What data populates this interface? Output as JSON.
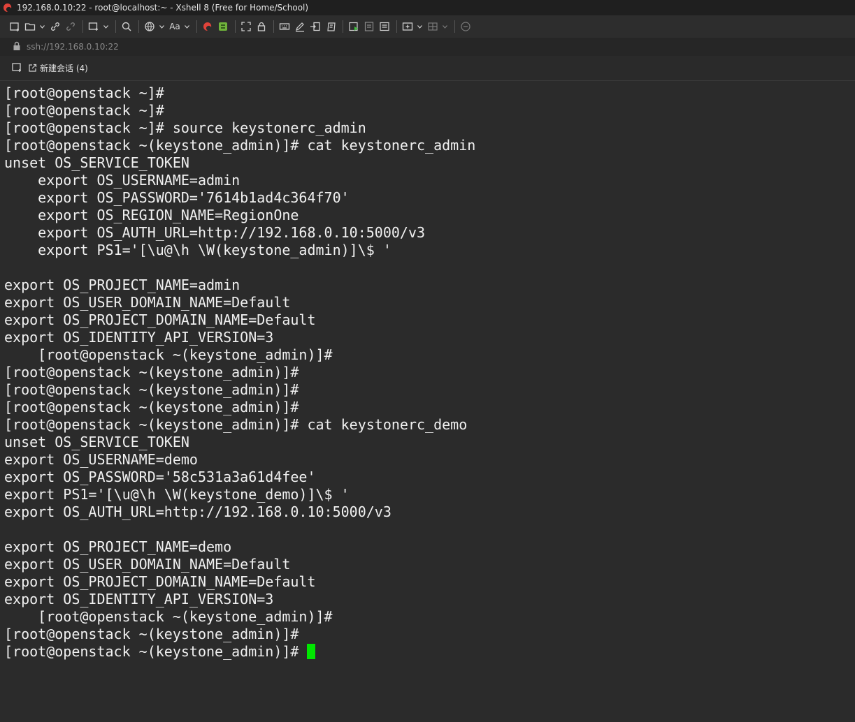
{
  "window": {
    "title": "192.168.0.10:22 - root@localhost:~ - Xshell 8 (Free for Home/School)"
  },
  "toolbar": {
    "font_button_label": "Aa"
  },
  "address": {
    "url": "ssh://192.168.0.10:22"
  },
  "tabs": [
    {
      "label": "新建会话 (4)"
    }
  ],
  "terminal": {
    "cursor_color": "#00e600",
    "lines": [
      "[root@openstack ~]#",
      "[root@openstack ~]#",
      "[root@openstack ~]# source keystonerc_admin",
      "[root@openstack ~(keystone_admin)]# cat keystonerc_admin",
      "unset OS_SERVICE_TOKEN",
      "    export OS_USERNAME=admin",
      "    export OS_PASSWORD='7614b1ad4c364f70'",
      "    export OS_REGION_NAME=RegionOne",
      "    export OS_AUTH_URL=http://192.168.0.10:5000/v3",
      "    export PS1='[\\u@\\h \\W(keystone_admin)]\\$ '",
      "",
      "export OS_PROJECT_NAME=admin",
      "export OS_USER_DOMAIN_NAME=Default",
      "export OS_PROJECT_DOMAIN_NAME=Default",
      "export OS_IDENTITY_API_VERSION=3",
      "    [root@openstack ~(keystone_admin)]#",
      "[root@openstack ~(keystone_admin)]#",
      "[root@openstack ~(keystone_admin)]#",
      "[root@openstack ~(keystone_admin)]#",
      "[root@openstack ~(keystone_admin)]# cat keystonerc_demo",
      "unset OS_SERVICE_TOKEN",
      "export OS_USERNAME=demo",
      "export OS_PASSWORD='58c531a3a61d4fee'",
      "export PS1='[\\u@\\h \\W(keystone_demo)]\\$ '",
      "export OS_AUTH_URL=http://192.168.0.10:5000/v3",
      "",
      "export OS_PROJECT_NAME=demo",
      "export OS_USER_DOMAIN_NAME=Default",
      "export OS_PROJECT_DOMAIN_NAME=Default",
      "export OS_IDENTITY_API_VERSION=3",
      "    [root@openstack ~(keystone_admin)]#",
      "[root@openstack ~(keystone_admin)]#"
    ],
    "prompt": "[root@openstack ~(keystone_admin)]# "
  }
}
